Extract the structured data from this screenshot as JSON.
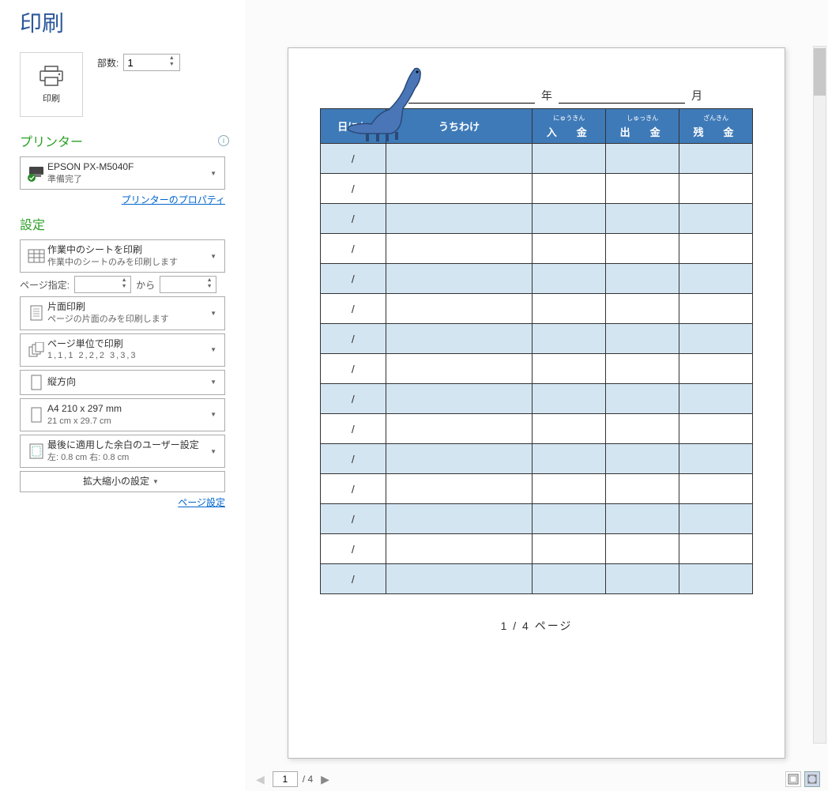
{
  "title": "印刷",
  "print_button_label": "印刷",
  "copies": {
    "label": "部数:",
    "value": "1"
  },
  "printer_section": {
    "header": "プリンター",
    "name": "EPSON PX-M5040F",
    "status": "準備完了",
    "properties_link": "プリンターのプロパティ"
  },
  "settings_section": {
    "header": "設定",
    "print_scope": {
      "title": "作業中のシートを印刷",
      "sub": "作業中のシートのみを印刷します"
    },
    "page_range": {
      "label": "ページ指定:",
      "from": "",
      "to_label": "から",
      "to": ""
    },
    "sides": {
      "title": "片面印刷",
      "sub": "ページの片面のみを印刷します"
    },
    "collate": {
      "title": "ページ単位で印刷",
      "sub": "1,1,1   2,2,2   3,3,3"
    },
    "orientation": {
      "title": "縦方向"
    },
    "paper": {
      "title": "A4 210 x 297 mm",
      "sub": "21 cm x 29.7 cm"
    },
    "margins": {
      "title": "最後に適用した余白のユーザー設定",
      "sub": "左: 0.8 cm   右: 0.8 cm"
    },
    "scaling": {
      "title": "拡大縮小の設定"
    },
    "page_setup_link": "ページ設定"
  },
  "preview": {
    "year_label": "年",
    "month_label": "月",
    "table_headers": {
      "date": "日にち",
      "desc": "うちわけ",
      "income_ruby": "にゅうきん",
      "income": "入　金",
      "expense_ruby": "しゅっきん",
      "expense": "出　金",
      "balance_ruby": "ざんきん",
      "balance": "残　金"
    },
    "date_cell": "/",
    "row_count": 15,
    "footer": "1 / 4 ページ"
  },
  "nav": {
    "current": "1",
    "total": "/ 4"
  }
}
